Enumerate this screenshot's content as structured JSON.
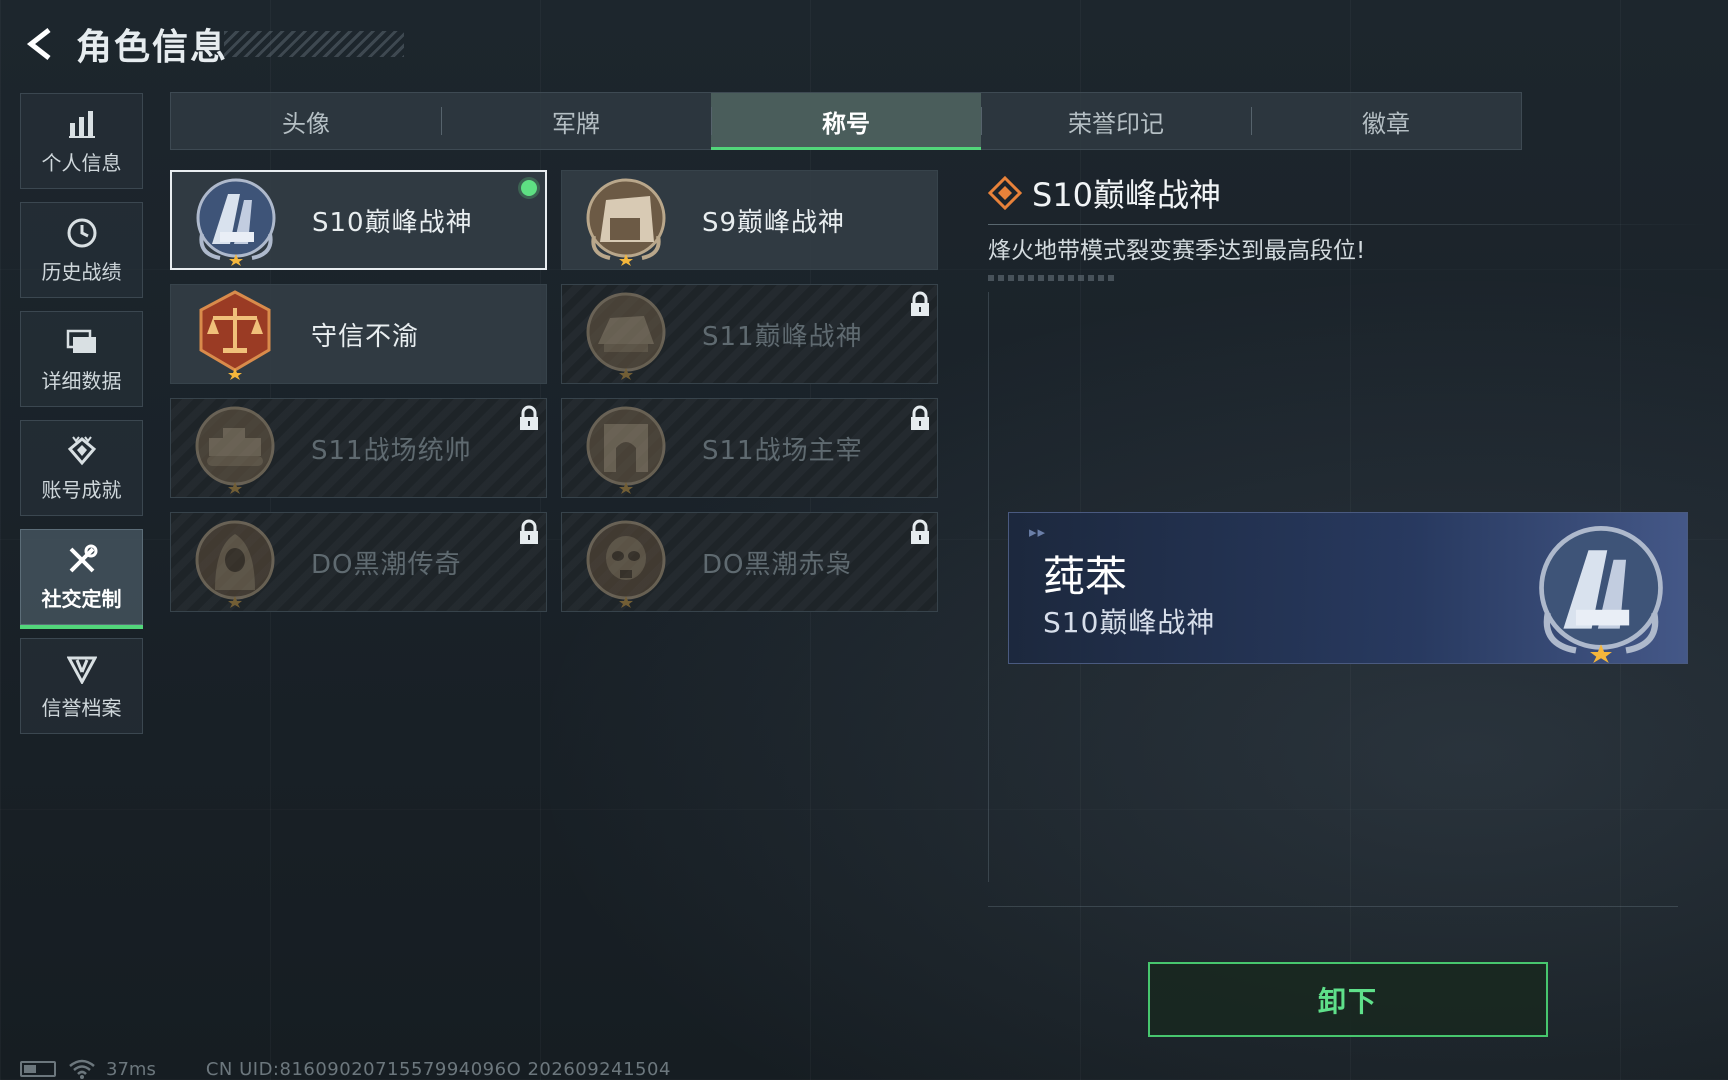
{
  "header": {
    "title": "角色信息"
  },
  "sidebar": {
    "items": [
      {
        "label": "个人信息",
        "icon": "bar-chart-icon"
      },
      {
        "label": "历史战绩",
        "icon": "clock-icon"
      },
      {
        "label": "详细数据",
        "icon": "folder-icon"
      },
      {
        "label": "账号成就",
        "icon": "achievement-icon"
      },
      {
        "label": "社交定制",
        "icon": "tools-icon",
        "active": true
      },
      {
        "label": "信誉档案",
        "icon": "credit-shield-icon"
      }
    ]
  },
  "tabs": [
    {
      "label": "头像"
    },
    {
      "label": "军牌"
    },
    {
      "label": "称号",
      "active": true
    },
    {
      "label": "荣誉印记"
    },
    {
      "label": "徽章"
    }
  ],
  "titles": [
    {
      "label": "S10巅峰战神",
      "state": "equipped",
      "emblem": "peak-emblem-icon"
    },
    {
      "label": "S9巅峰战神",
      "state": "owned",
      "emblem": "fortress-emblem-icon"
    },
    {
      "label": "守信不渝",
      "state": "owned",
      "emblem": "scales-emblem-icon"
    },
    {
      "label": "S11巅峰战神",
      "state": "locked",
      "emblem": "rock-emblem-icon"
    },
    {
      "label": "S11战场统帅",
      "state": "locked",
      "emblem": "tank-emblem-icon"
    },
    {
      "label": "S11战场主宰",
      "state": "locked",
      "emblem": "arch-emblem-icon"
    },
    {
      "label": "DO黑潮传奇",
      "state": "locked",
      "emblem": "hooded-emblem-icon"
    },
    {
      "label": "DO黑潮赤枭",
      "state": "locked",
      "emblem": "skull-emblem-icon"
    }
  ],
  "detail": {
    "title": "S10巅峰战神",
    "description": "烽火地带模式裂变赛季达到最高段位!"
  },
  "preview": {
    "player_name": "莼苯",
    "title": "S10巅峰战神"
  },
  "actions": {
    "unequip_label": "卸下"
  },
  "status": {
    "ping": "37ms",
    "uid": "CN UID:8160902071557994096O 202609241504"
  },
  "colors": {
    "accent": "#52d67a",
    "selected_border": "#e9eef1",
    "preview_bg": "#2a3a62"
  }
}
